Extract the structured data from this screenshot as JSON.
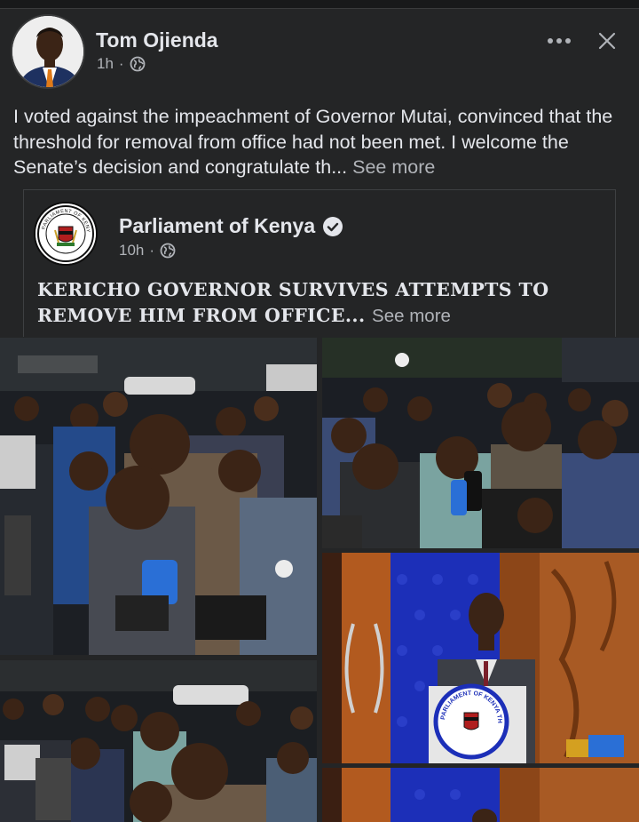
{
  "post": {
    "author": "Tom Ojienda",
    "time": "1h",
    "separator": "·",
    "text": "I voted against the impeachment of Governor Mutai, convinced that the threshold for removal from office had not been met. I welcome the Senate’s decision and congratulate th...",
    "see_more": "See more",
    "icons": {
      "privacy": "globe-icon",
      "more": "more-options-icon",
      "close": "close-icon"
    }
  },
  "shared": {
    "page_name": "Parliament of Kenya",
    "time": "10h",
    "separator": "·",
    "text": "KERICHO GOVERNOR SURVIVES ATTEMPTS TO REMOVE HIM FROM OFFICE...",
    "see_more": "See more",
    "logo_text": "PARLIAMENT OF KENYA",
    "icons": {
      "verified": "verified-badge-icon",
      "privacy": "globe-icon"
    }
  },
  "photos": {
    "podium_seal_text": "PARLIAMENT OF KENYA THE SENATE"
  },
  "colors": {
    "background": "#242526",
    "text_primary": "#e4e6eb",
    "text_secondary": "#b0b3b8",
    "verified": "#e4e6eb",
    "senate_blue": "#1c2fb8"
  }
}
